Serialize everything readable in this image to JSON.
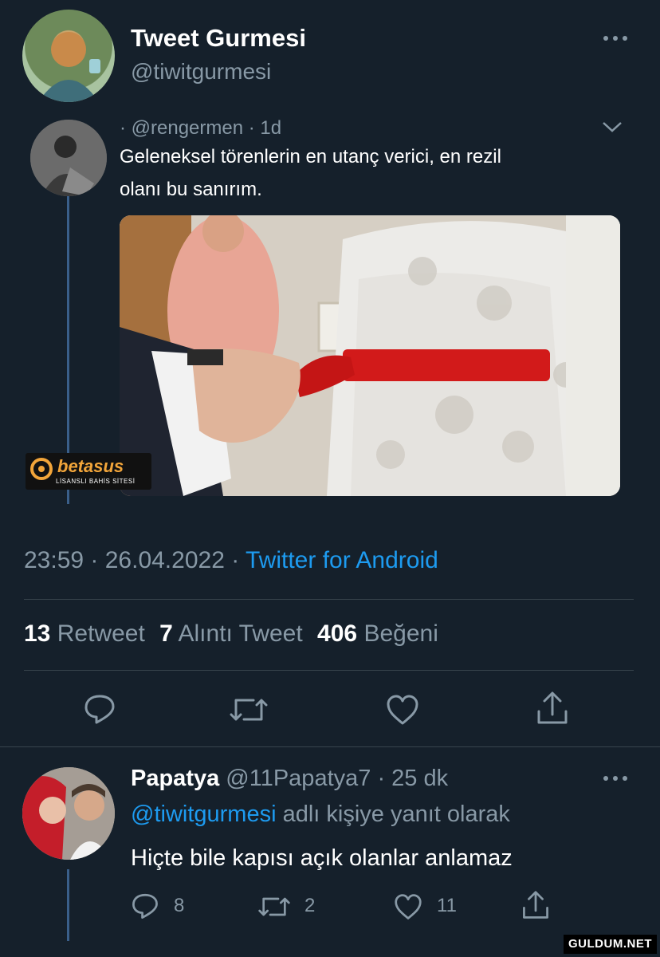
{
  "main_tweet": {
    "display_name": "Tweet Gurmesi",
    "handle": "@tiwitgurmesi",
    "timestamp": "23:59 · 26.04.2022 ·",
    "source": "Twitter for Android",
    "stats": [
      {
        "count": "13",
        "label": "Retweet"
      },
      {
        "count": "7",
        "label": "Alıntı Tweet"
      },
      {
        "count": "406",
        "label": "Beğeni"
      }
    ]
  },
  "quoted_tweet": {
    "meta": "· @rengermen · 1d",
    "text_line1": "Geleneksel törenlerin en utanç verici, en rezil",
    "text_line2": "olanı bu sanırım.",
    "watermark_brand": "betasus",
    "watermark_sub": "LİSANSLI BAHİS SİTESİ"
  },
  "reply": {
    "display_name": "Papatya",
    "handle_time": "@11Papatya7 · 25 dk",
    "reply_to_handle": "@tiwitgurmesi",
    "reply_to_suffix": "adlı kişiye yanıt olarak",
    "text": "Hiçte bile kapısı açık olanlar anlamaz",
    "counts": {
      "replies": "8",
      "retweets": "2",
      "likes": "11"
    }
  },
  "site_watermark": "GULDUM.NET",
  "colors": {
    "background": "#15202b",
    "accent": "#1d9bf0",
    "muted_text": "#8899a6",
    "divider": "#38444d",
    "ribbon": "#d21a1a"
  }
}
